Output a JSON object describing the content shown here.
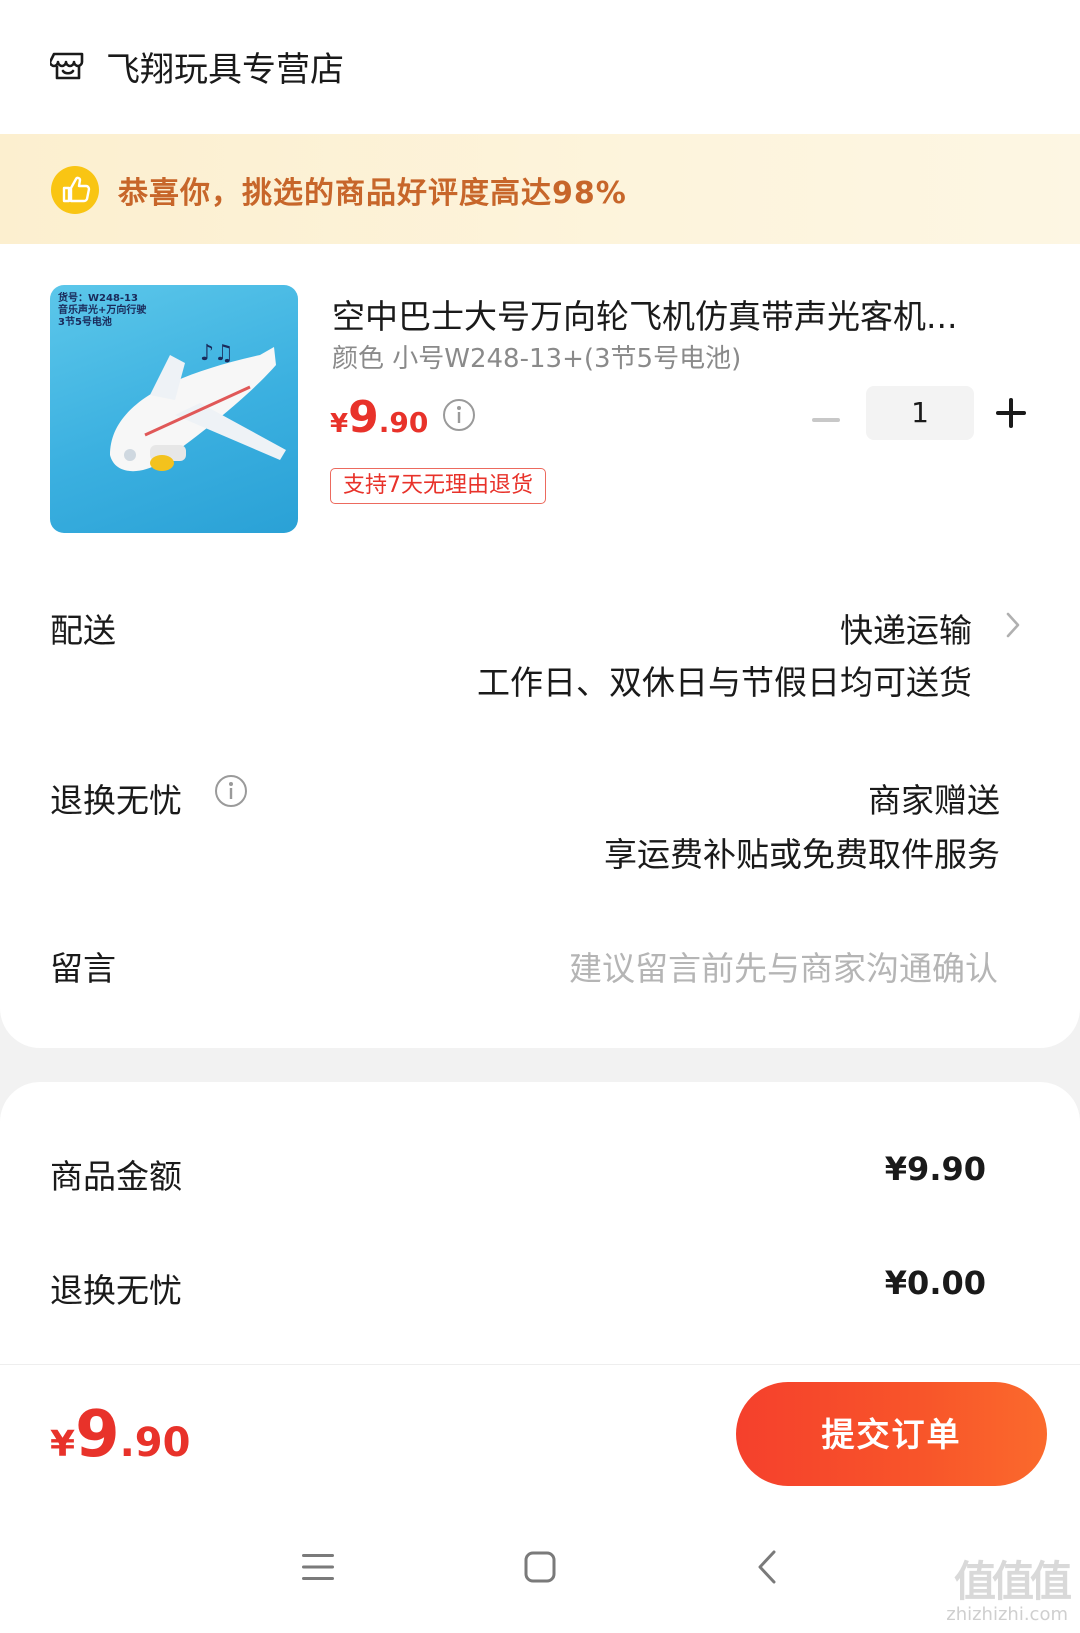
{
  "store": {
    "name": "飞翔玩具专营店",
    "icon": "store-icon"
  },
  "banner": {
    "text": "恭喜你，挑选的商品好评度高达98%",
    "icon": "thumbs-up-icon"
  },
  "product": {
    "title": "空中巴士大号万向轮飞机仿真带声光客机...",
    "spec": "颜色  小号W248-13+(3节5号电池)",
    "image_label": "货号：W248-13\n音乐声光+万向行驶\n3节5号电池",
    "price_symbol": "¥",
    "price_int": "9",
    "price_dec": ".90",
    "quantity": "1",
    "return_badge": "支持7天无理由退货"
  },
  "delivery": {
    "label": "配送",
    "method": "快递运输",
    "note": "工作日、双休日与节假日均可送货"
  },
  "worry_free": {
    "label": "退换无忧",
    "value": "商家赠送",
    "note": "享运费补贴或免费取件服务"
  },
  "message": {
    "label": "留言",
    "placeholder": "建议留言前先与商家沟通确认"
  },
  "summary": {
    "goods_label": "商品金额",
    "goods_value": "¥9.90",
    "worry_label": "退换无忧",
    "worry_value": "¥0.00"
  },
  "footer": {
    "total_symbol": "¥",
    "total_int": "9",
    "total_dec": ".90",
    "submit_label": "提交订单"
  },
  "watermark": {
    "main": "值值值",
    "sub": "zhizhizhi.com"
  },
  "colors": {
    "accent": "#e8322a",
    "banner_text": "#c7662a",
    "button": "#f5402c"
  }
}
